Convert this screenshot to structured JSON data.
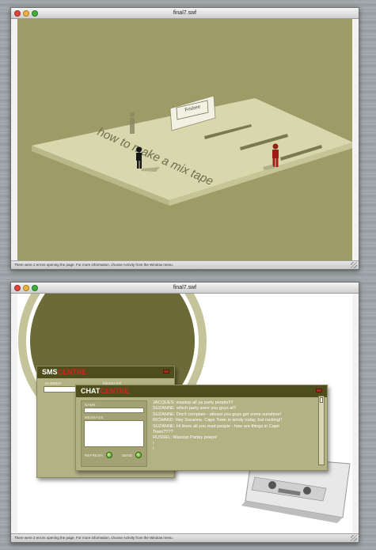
{
  "window1": {
    "title": "final7.swf",
    "status": "There were 2 errors opening the page. For more information, choose Activity from the Window menu.",
    "scene": {
      "floor_text": "how to make a mix tape",
      "sign_text": "Frisbee",
      "floor_color": "#d7d6ad",
      "background_color": "#9f9b66"
    }
  },
  "window2": {
    "title": "final7.swf",
    "status": "There were 2 errors opening the page. For more information, choose Activity from the Window menu.",
    "sms": {
      "title_a": "SMS",
      "title_b": "CENTRE",
      "number_label": "NUMBER",
      "message_label": "MESSAGE"
    },
    "chat": {
      "title_a": "CHAT",
      "title_b": "CENTRE",
      "name_label": "NAME",
      "message_label": "MESSAGE",
      "refresh_label": "REFRESH",
      "send_label": "SEND",
      "messages": [
        "JACQUES: wassup all ya party people!!!!",
        "SUZANNE: which party were you guys at?",
        "SUZANNE: Don't complain - atleast you guys get some sunshine!",
        "RICHARD: Hey Suzanne, Cape Town is windy today, but rocking!!",
        "SUZANNE: Hi there all you mad people - how are things in Cape",
        "Town????",
        "RUSSEL: Wassup Partay peeps!",
        "!",
        "!"
      ]
    },
    "colors": {
      "panel": "#b3b285",
      "panel_header": "#4d4e1c",
      "accent_red": "#c42b1f",
      "olive_dark": "#6d6b38"
    }
  }
}
